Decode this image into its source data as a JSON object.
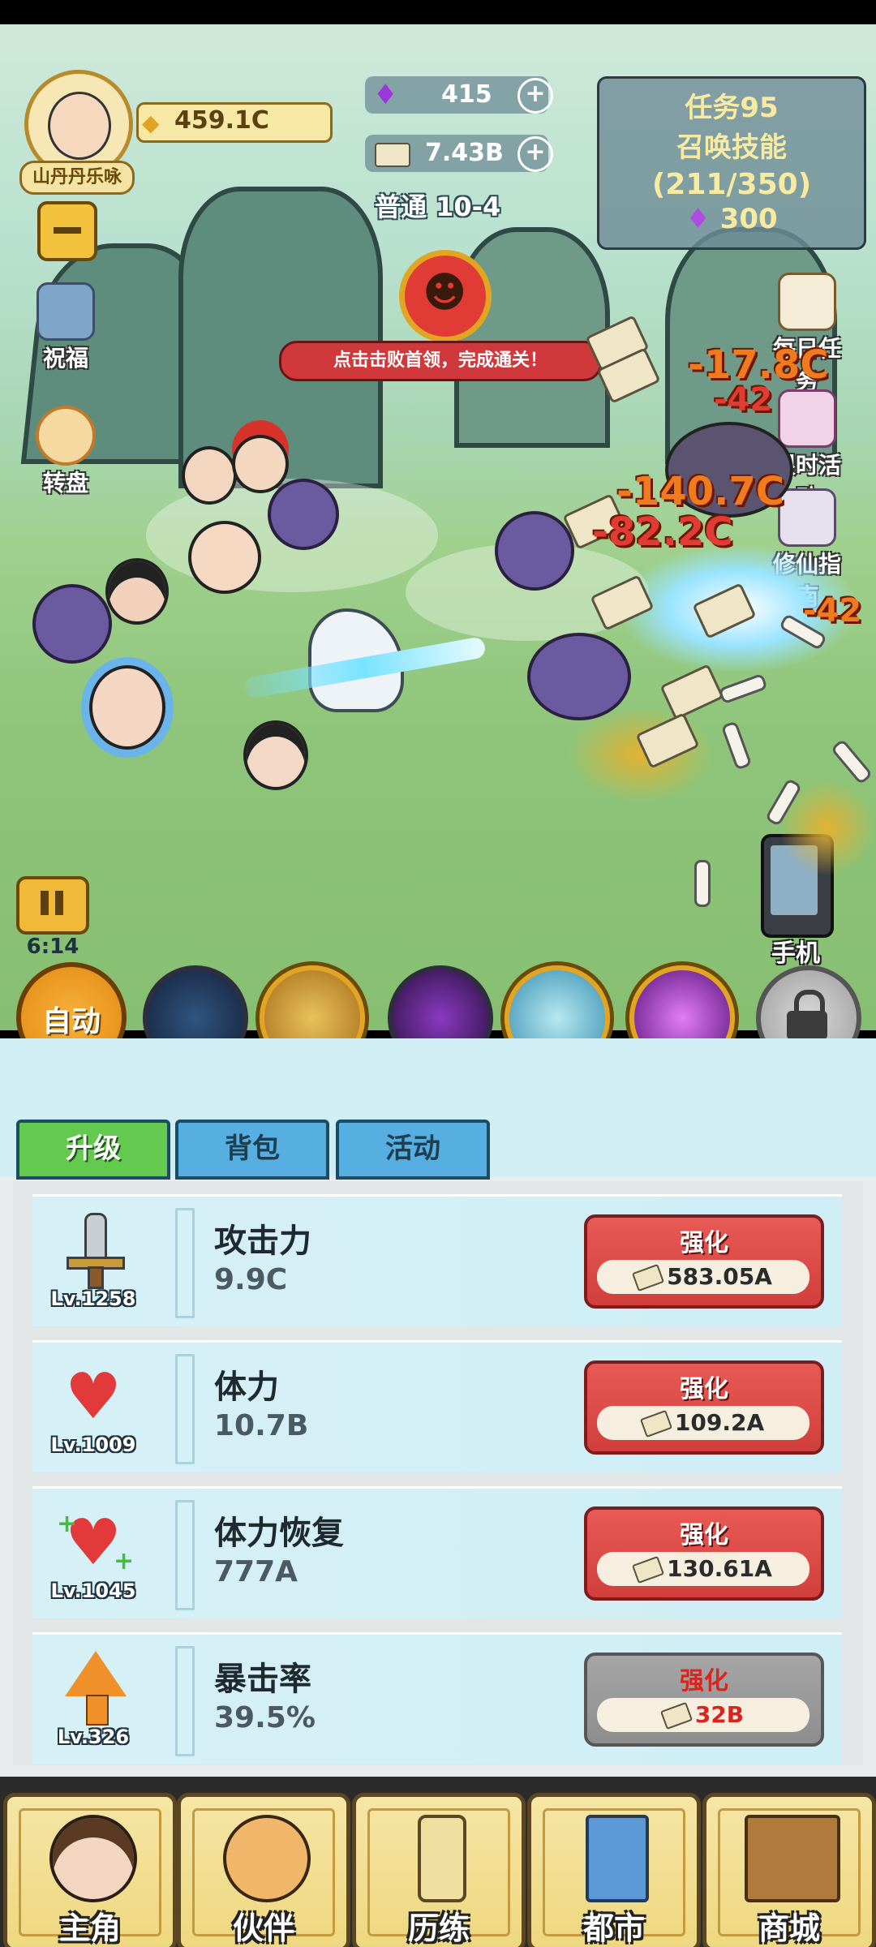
{
  "player": {
    "name": "山丹丹乐咏",
    "gold": "459.1C"
  },
  "currency": {
    "gems": "415",
    "cash": "7.43B",
    "stage": "普通 10-4"
  },
  "quest": {
    "title": "任务95",
    "name": "召唤技能",
    "progress": "(211/350)",
    "reward": "300"
  },
  "boss_banner": "点击击败首领，完成通关！",
  "left_buttons": {
    "blessing": "祝福",
    "wheel": "转盘"
  },
  "right_buttons": {
    "daily": "每日任务",
    "limited": "限时活动",
    "guide": "修仙指南",
    "phone": "手机"
  },
  "timer": "6:14",
  "damage": [
    "-17.8C",
    "-42",
    "-140.7C",
    "-82.2C",
    "-42"
  ],
  "skills": {
    "auto": "自动"
  },
  "tabs": [
    "升级",
    "背包",
    "活动"
  ],
  "upgrades": [
    {
      "name": "攻击力",
      "value": "9.9C",
      "level": "Lv.1258",
      "btn": "强化",
      "cost": "583.05A",
      "enabled": true
    },
    {
      "name": "体力",
      "value": "10.7B",
      "level": "Lv.1009",
      "btn": "强化",
      "cost": "109.2A",
      "enabled": true
    },
    {
      "name": "体力恢复",
      "value": "777A",
      "level": "Lv.1045",
      "btn": "强化",
      "cost": "130.61A",
      "enabled": true
    },
    {
      "name": "暴击率",
      "value": "39.5%",
      "level": "Lv.326",
      "btn": "强化",
      "cost": "32B",
      "enabled": false
    }
  ],
  "nav": [
    "主角",
    "伙伴",
    "历练",
    "都市",
    "商城"
  ],
  "colors": {
    "accent_red": "#d13f3c",
    "tab_active": "#5cc74a",
    "tab_inactive": "#4da7dd",
    "gold": "#e2a521"
  }
}
